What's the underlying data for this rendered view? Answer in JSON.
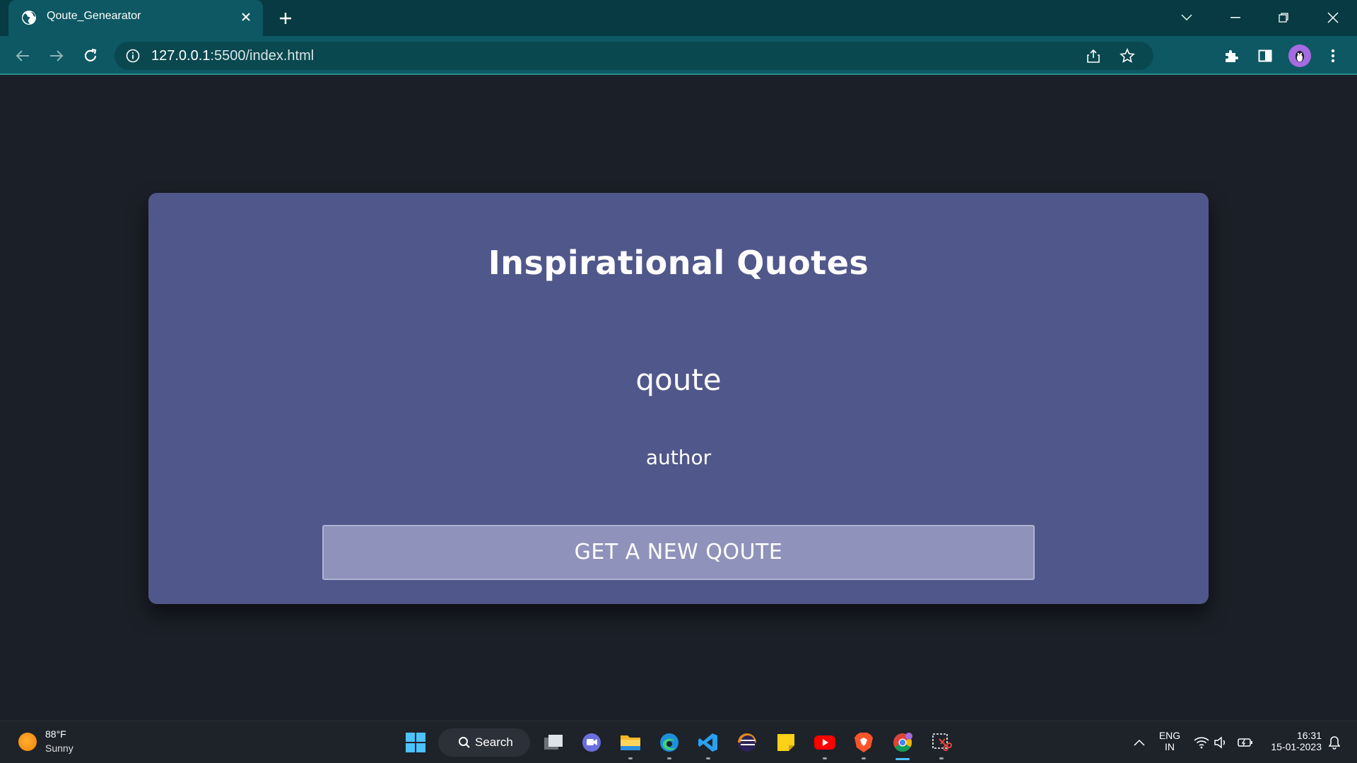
{
  "browser": {
    "tab_title": "Qoute_Genearator",
    "url_host": "127.0.0.1",
    "url_rest": ":5500/index.html"
  },
  "page": {
    "title": "Inspirational Quotes",
    "quote": "qoute",
    "author": "author",
    "button_label": "GET A NEW QOUTE"
  },
  "taskbar": {
    "weather_temp": "88°F",
    "weather_condition": "Sunny",
    "search_label": "Search",
    "language": "ENG",
    "region": "IN",
    "time": "16:31",
    "date": "15-01-2023"
  },
  "colors": {
    "page_background": "#1b1f27",
    "card": "#50578a",
    "button": "#8f93bb",
    "browser_frame": "#073a42",
    "browser_toolbar": "#0d5862"
  }
}
